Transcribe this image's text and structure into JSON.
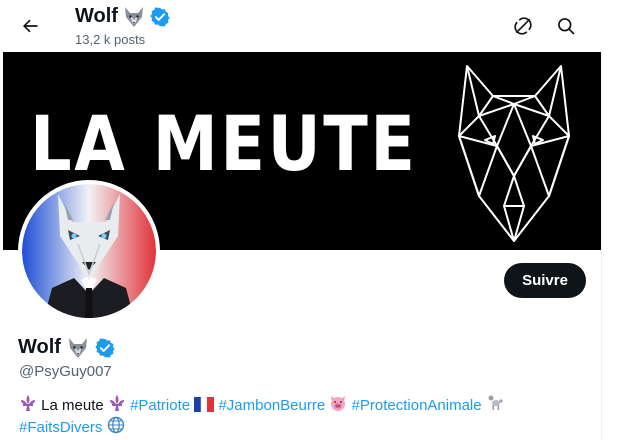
{
  "header": {
    "name": "Wolf",
    "posts_count": "13,2 k posts"
  },
  "banner": {
    "text": "LA MEUTE"
  },
  "profile": {
    "name": "Wolf",
    "handle": "@PsyGuy007",
    "follow_label": "Suivre",
    "verified": true
  },
  "bio": {
    "intro": "La meute",
    "tag1": "#Patriote",
    "tag2": "#JambonBeurre",
    "tag3": "#ProtectionAnimale",
    "tag4": "#FaitsDivers"
  },
  "colors": {
    "accent": "#1d9bf0",
    "text": "#0f1419",
    "muted": "#536471",
    "banner_bg": "#000000"
  }
}
